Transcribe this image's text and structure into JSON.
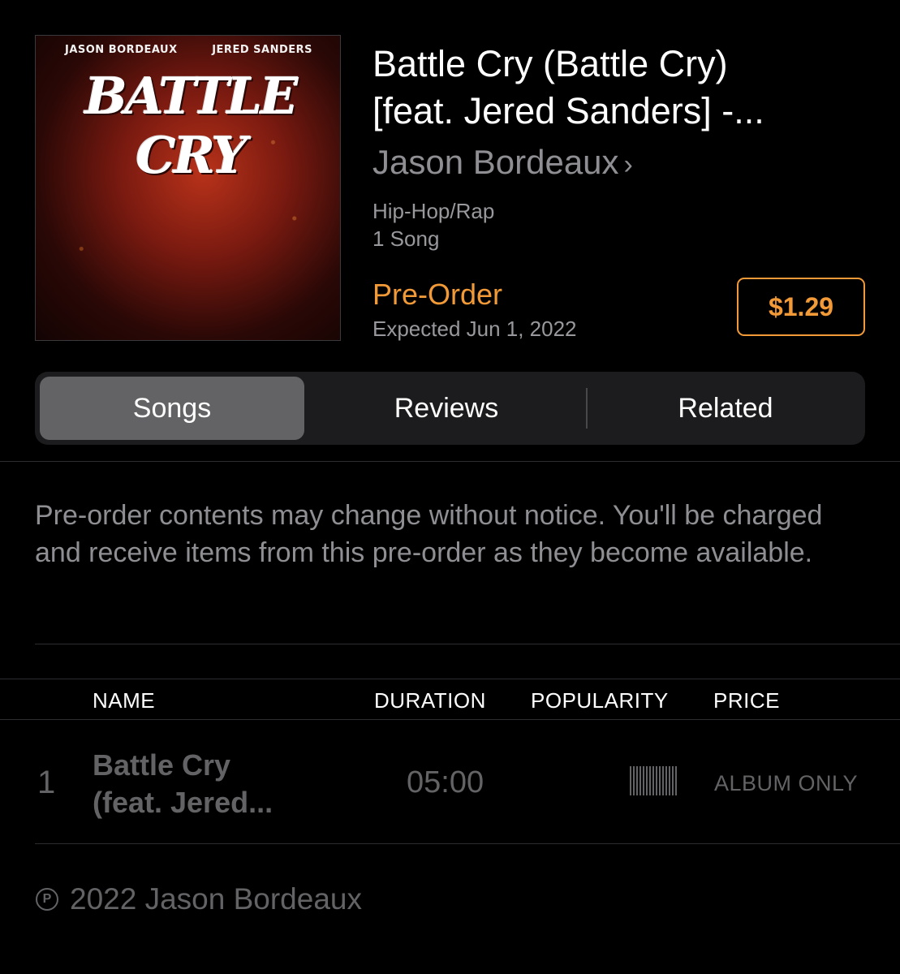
{
  "album": {
    "artwork": {
      "artist_left": "JASON BORDEAUX",
      "artist_right": "JERED SANDERS",
      "title_text": "BATTLE CRY"
    },
    "title_line1": "Battle Cry (Battle Cry)",
    "title_line2": "[feat. Jered Sanders] -...",
    "artist": "Jason Bordeaux",
    "genre": "Hip-Hop/Rap",
    "song_count": "1 Song",
    "preorder_label": "Pre-Order",
    "expected": "Expected Jun 1, 2022",
    "price": "$1.29"
  },
  "tabs": [
    {
      "label": "Songs",
      "selected": true
    },
    {
      "label": "Reviews",
      "selected": false
    },
    {
      "label": "Related",
      "selected": false
    }
  ],
  "notice": "Pre-order contents may change without notice. You'll be charged and receive items from this pre-order as they become available.",
  "table": {
    "headers": {
      "name": "NAME",
      "duration": "DURATION",
      "popularity": "POPULARITY",
      "price": "PRICE"
    },
    "rows": [
      {
        "number": "1",
        "name_line1": "Battle Cry",
        "name_line2": "(feat. Jered...",
        "duration": "05:00",
        "price": "ALBUM ONLY"
      }
    ]
  },
  "copyright": {
    "symbol": "P",
    "text": "2022 Jason Bordeaux"
  },
  "colors": {
    "accent": "#f19a37",
    "background": "#000000",
    "secondary_text": "#8e8e93",
    "dim_text": "#636366"
  }
}
